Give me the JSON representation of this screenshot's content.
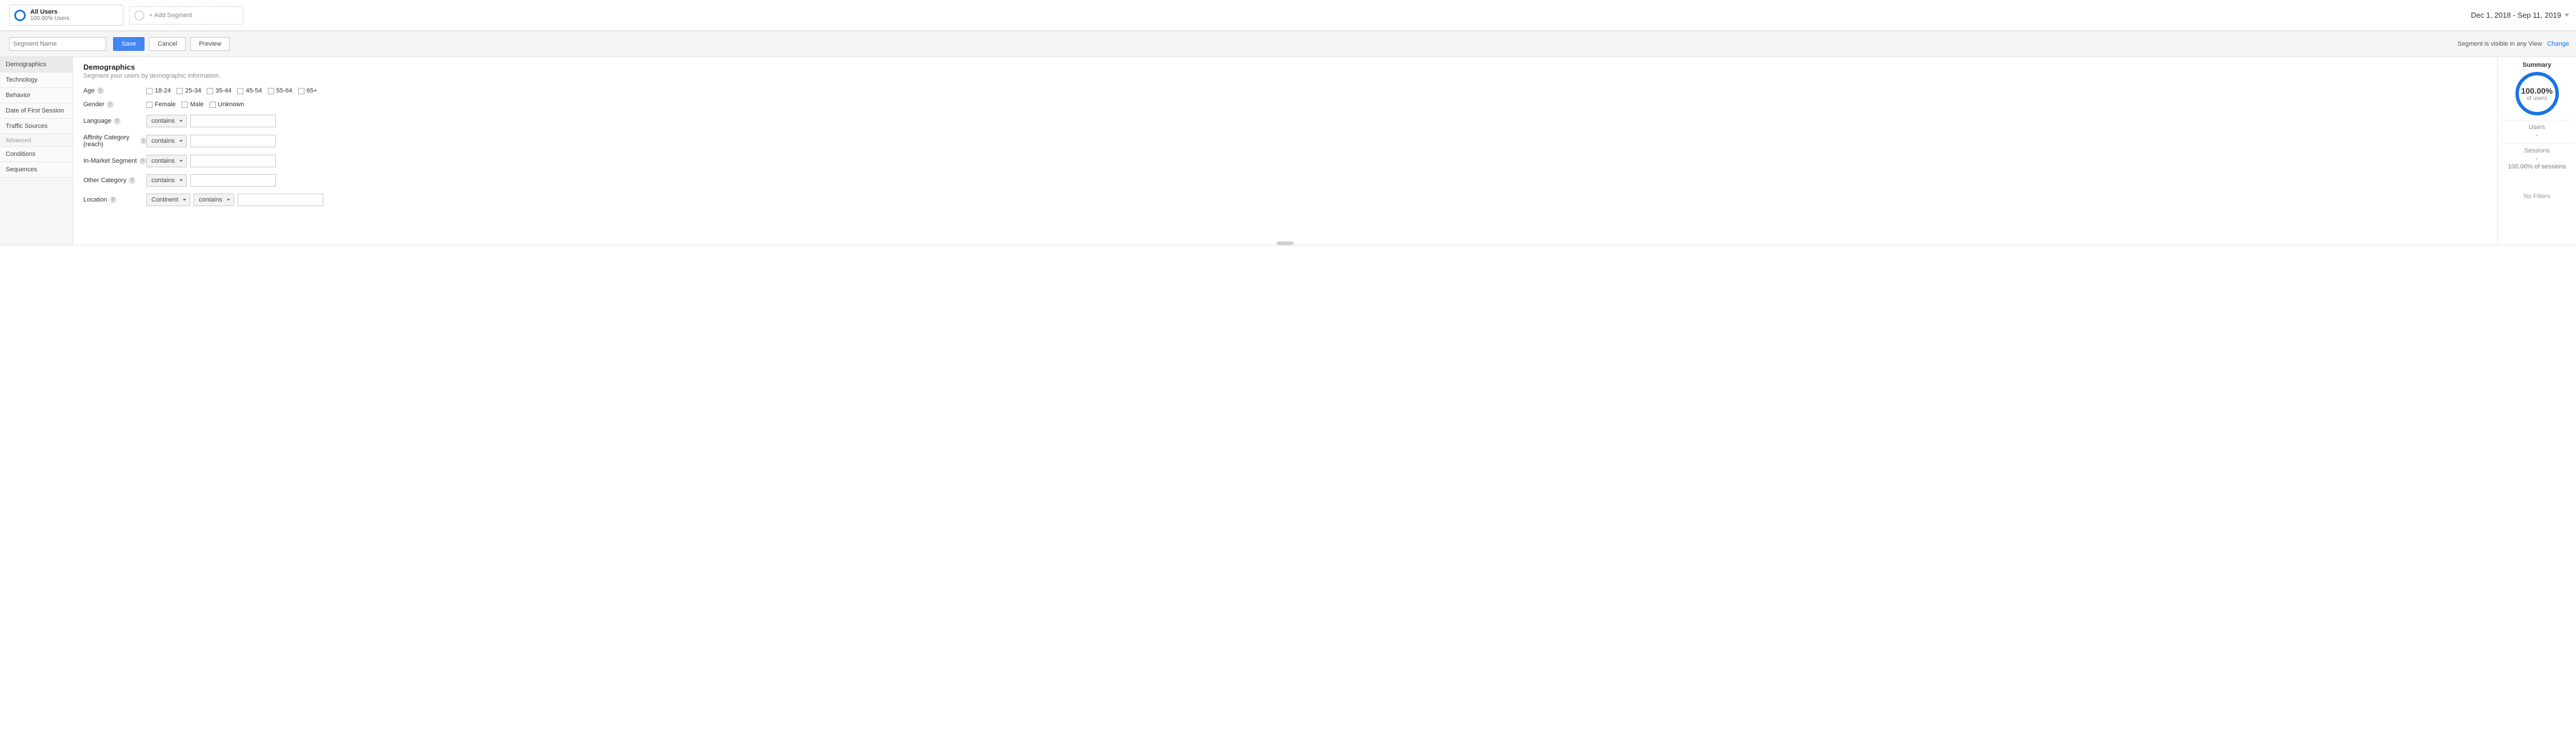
{
  "top": {
    "segment_title": "All Users",
    "segment_sub": "100.00% Users",
    "add_segment": "+ Add Segment",
    "date_range": "Dec 1, 2018 - Sep 11, 2019"
  },
  "toolbar": {
    "segname_placeholder": "Segment Name",
    "save": "Save",
    "cancel": "Cancel",
    "preview": "Preview",
    "visible_text": "Segment is visible in any View",
    "change": "Change"
  },
  "nav": {
    "items": [
      "Demographics",
      "Technology",
      "Behavior",
      "Date of First Session",
      "Traffic Sources"
    ],
    "advanced_label": "Advanced",
    "advanced_items": [
      "Conditions",
      "Sequences"
    ]
  },
  "form": {
    "title": "Demographics",
    "subtitle": "Segment your users by demographic information.",
    "age_label": "Age",
    "age_options": [
      "18-24",
      "25-34",
      "35-44",
      "45-54",
      "55-64",
      "65+"
    ],
    "gender_label": "Gender",
    "gender_options": [
      "Female",
      "Male",
      "Unknown"
    ],
    "language_label": "Language",
    "affinity_label": "Affinity Category (reach)",
    "inmarket_label": "In-Market Segment",
    "othercat_label": "Other Category",
    "location_label": "Location",
    "contains": "contains",
    "location_type": "Continent"
  },
  "summary": {
    "title": "Summary",
    "pct": "100.00%",
    "of_users": "of users",
    "users_label": "Users",
    "users_value": "-",
    "sessions_label": "Sessions",
    "sessions_value": "-",
    "sessions_pct": "100.00% of sessions",
    "no_filters": "No Filters"
  }
}
